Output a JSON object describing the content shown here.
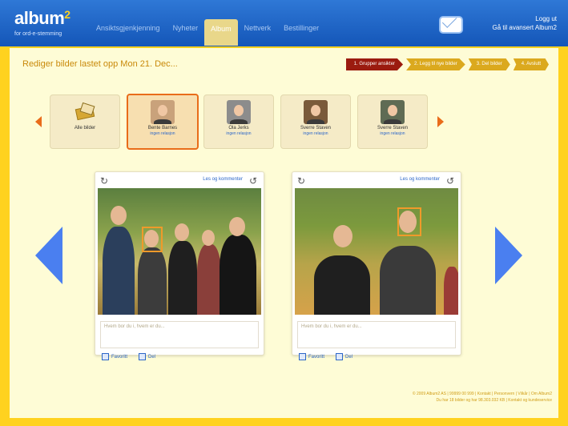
{
  "header": {
    "logo_text": "album",
    "logo_suffix": "2",
    "tagline": "for ord-e-stemming",
    "nav": [
      "Ansiktsgjenkjenning",
      "Nyheter",
      "Album",
      "Nettverk",
      "Bestillinger"
    ],
    "active_nav_index": 2,
    "user_links": [
      "Logg ut",
      "Gå til avansert Album2"
    ]
  },
  "main": {
    "title": "Rediger bilder lastet opp Mon 21. Dec...",
    "steps": [
      "1. Grupper ansikter",
      "2. Legg til nye bilder",
      "3. Del bilder",
      "4. Avslutt"
    ],
    "people": [
      {
        "name": "Alle bilder",
        "link": ""
      },
      {
        "name": "Bente Barnes",
        "link": "ingen relasjon"
      },
      {
        "name": "Ola Jerks",
        "link": "ingen relasjon"
      },
      {
        "name": "Sverre Staven",
        "link": "ingen relasjon"
      },
      {
        "name": "Sverre Staven",
        "link": "ingen relasjon"
      }
    ],
    "photos": [
      {
        "link": "Les og kommenter",
        "caption": "Hvem bor du i, hvem er du...",
        "check_a": "Favoritt",
        "check_b": "Del"
      },
      {
        "link": "Les og kommenter",
        "caption": "Hvem bor du i, hvem er du...",
        "check_a": "Favoritt",
        "check_b": "Del"
      }
    ]
  },
  "footer": {
    "line1": "© 2009 Album2 AS | 99999 00 999 | Kontakt | Personvern | Vilkår | Om Album2",
    "line2": "Du har 18 bilder og har 98.303.032 KB | Kontakt og kundeservice"
  },
  "colors": {
    "accent": "#e96c1a",
    "nav_blue": "#1456b8",
    "panel": "#fefcd6",
    "frame": "#ffd21f",
    "arrow_blue": "#4a7ff0"
  }
}
